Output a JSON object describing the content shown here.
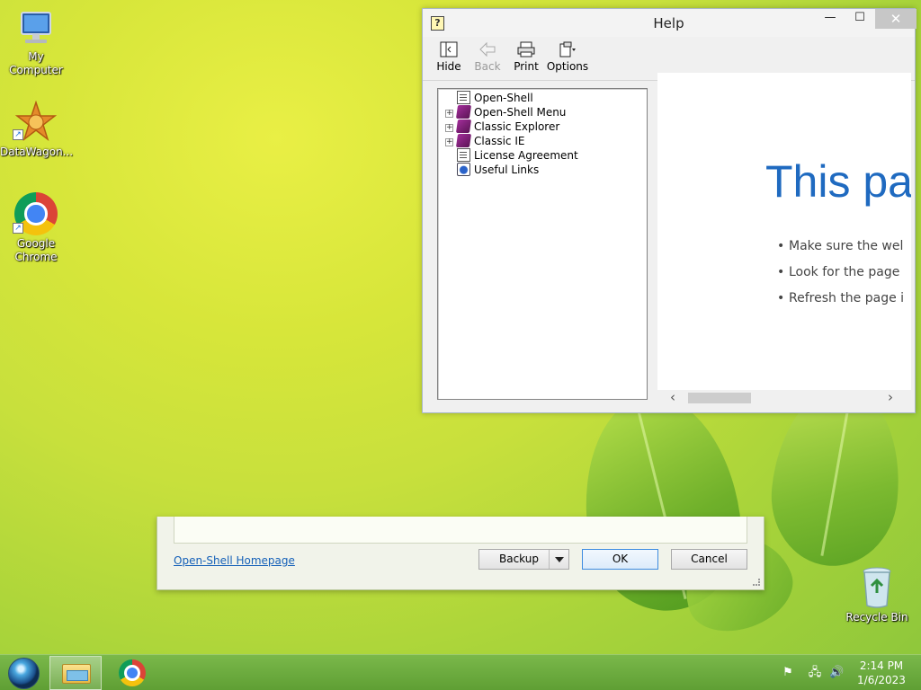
{
  "desktop": {
    "icons": [
      {
        "label": "My Computer"
      },
      {
        "label": "DataWagon..."
      },
      {
        "label": "Google Chrome"
      },
      {
        "label": "Recycle Bin"
      }
    ]
  },
  "help_window": {
    "title": "Help",
    "controls": {
      "minimize": "—",
      "maximize": "☐",
      "close": "✕"
    },
    "toolbar": {
      "hide": "Hide",
      "back": "Back",
      "print": "Print",
      "options": "Options"
    },
    "tree": [
      {
        "label": "Open-Shell",
        "type": "page",
        "expandable": false
      },
      {
        "label": "Open-Shell Menu",
        "type": "book",
        "expandable": true
      },
      {
        "label": "Classic Explorer",
        "type": "book",
        "expandable": true
      },
      {
        "label": "Classic IE",
        "type": "book",
        "expandable": true
      },
      {
        "label": "License Agreement",
        "type": "page",
        "expandable": false
      },
      {
        "label": "Useful Links",
        "type": "links",
        "expandable": false
      }
    ],
    "content": {
      "heading": "This pag",
      "bullets": [
        "Make sure the wel",
        "Look for the page",
        "Refresh the page i"
      ]
    }
  },
  "settings_dialog": {
    "homepage_link": "Open-Shell Homepage",
    "backup_button": "Backup",
    "ok_button": "OK",
    "cancel_button": "Cancel"
  },
  "taskbar": {
    "clock_time": "2:14 PM",
    "clock_date": "1/6/2023"
  },
  "colors": {
    "accent_link": "#1560b8",
    "content_heading": "#1f6ac0",
    "taskbar": "#6aa93c"
  }
}
